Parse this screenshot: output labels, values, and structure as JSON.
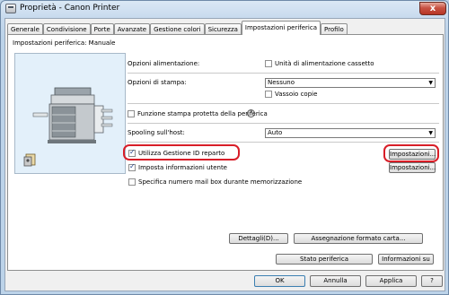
{
  "window": {
    "title": "Proprietà - Canon Printer",
    "close_glyph": "x"
  },
  "tabs": [
    {
      "label": "Generale"
    },
    {
      "label": "Condivisione"
    },
    {
      "label": "Porte"
    },
    {
      "label": "Avanzate"
    },
    {
      "label": "Gestione colori"
    },
    {
      "label": "Sicurezza"
    },
    {
      "label": "Impostazioni periferica"
    },
    {
      "label": "Profilo"
    }
  ],
  "active_tab": "Impostazioni periferica",
  "device_settings_label": "Impostazioni periferica: Manuale",
  "rows": {
    "power_options_label": "Opzioni alimentazione:",
    "cassette_unit_label": "Unità di alimentazione cassetto",
    "output_options_label": "Opzioni di stampa:",
    "output_select_value": "Nessuno",
    "copy_tray_label": "Vassoio copie",
    "secure_print_label": "Funzione stampa protetta della periferica",
    "spooling_label": "Spooling sull'host:",
    "spooling_select_value": "Auto",
    "dept_id_label": "Utilizza Gestione ID reparto",
    "user_info_label": "Imposta informazioni utente",
    "mailbox_label": "Specifica numero mail box durante memorizzazione"
  },
  "checkboxes": {
    "cassette_unit": false,
    "copy_tray": false,
    "secure_print": false,
    "dept_id": true,
    "user_info": true,
    "mailbox": false
  },
  "buttons": {
    "settings_1": "Impostazioni...",
    "settings_2": "Impostazioni...",
    "details": "Dettagli(D)...",
    "paper_format": "Assegnazione formato carta...",
    "device_status": "Stato periferica",
    "info": "Informazioni su",
    "ok": "OK",
    "cancel": "Annulla",
    "apply": "Applica",
    "help": "?"
  },
  "colors": {
    "highlight": "#d81e28",
    "title_gradient": "#c6d9ed",
    "close_button": "#c75243"
  }
}
